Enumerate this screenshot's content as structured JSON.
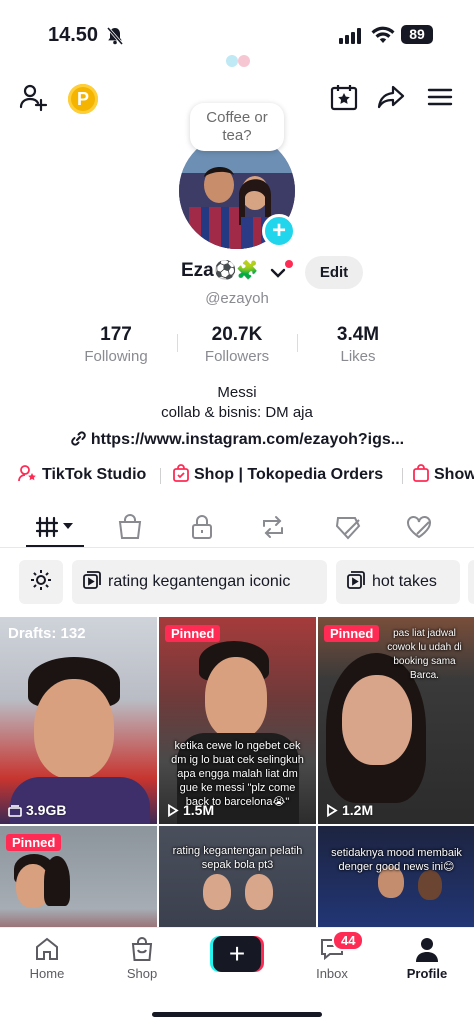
{
  "status_bar": {
    "time": "14.50",
    "battery": "89"
  },
  "profile": {
    "bubble_text": "Coffee or tea?",
    "name": "Eza",
    "name_emoji": "⚽🧩",
    "handle": "@ezayoh",
    "edit_label": "Edit",
    "stats": [
      {
        "value": "177",
        "label": "Following"
      },
      {
        "value": "20.7K",
        "label": "Followers"
      },
      {
        "value": "3.4M",
        "label": "Likes"
      }
    ],
    "bio_line1": "Messi",
    "bio_line2": "collab & bisnis: DM aja",
    "link": "https://www.instagram.com/ezayoh?igs..."
  },
  "shortcuts": [
    "TikTok Studio",
    "Shop | Tokopedia Orders",
    "Show"
  ],
  "playlists": [
    "rating kegantengan iconic",
    "hot takes"
  ],
  "grid": [
    {
      "drafts": "Drafts: 132",
      "views": "3.9GB"
    },
    {
      "badge": "Pinned",
      "caption": "ketika cewe lo ngebet cek dm ig lo buat cek selingkuh apa engga malah liat dm gue ke messi \"plz come back to barcelona😭\"",
      "views": "1.5M"
    },
    {
      "badge": "Pinned",
      "caption": "pas liat jadwal cowok lu udah di booking sama Barca.",
      "views": "1.2M"
    },
    {
      "badge": "Pinned"
    },
    {
      "caption": "rating kegantengan pelatih sepak bola pt3"
    },
    {
      "caption": "setidaknya mood membaik denger good news ini😊"
    }
  ],
  "bottom_nav": {
    "home": "Home",
    "shop": "Shop",
    "create": "+",
    "inbox": "Inbox",
    "inbox_badge": "44",
    "profile": "Profile"
  },
  "colors": {
    "accent": "#fe2c55",
    "cyan": "#25f4ee",
    "plus": "#20d5ec",
    "coin": "#f5b400"
  },
  "icons": [
    "bell-slash-icon",
    "signal-icon",
    "wifi-icon",
    "add-friend-icon",
    "coin-icon",
    "calendar-star-icon",
    "share-icon",
    "menu-icon",
    "link-icon",
    "studio-icon",
    "shop-bag-icon",
    "grid-icon",
    "bag-icon",
    "lock-icon",
    "repost-icon",
    "hidden-icon",
    "liked-icon",
    "settings-gear-icon",
    "playlist-icon",
    "home-icon",
    "inbox-icon",
    "profile-icon"
  ]
}
